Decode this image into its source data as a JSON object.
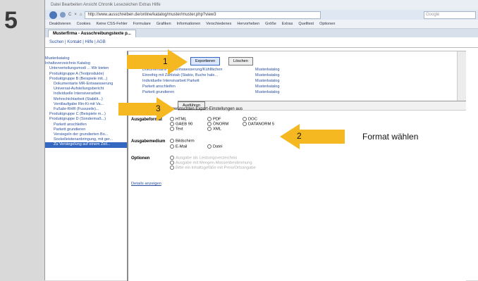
{
  "step": "5",
  "browser": {
    "title_bar": "Datei  Bearbeiten  Ansicht  Chronik  Lesezeichen  Extras  Hilfe",
    "url": "http://www.ausschreiben.de/online/katalog/muster/muster.php?view3",
    "search_placeholder": "Google",
    "bookmarks": [
      "Deaktivieren",
      "Cookies",
      "Keine CSS-Fehler",
      "Formulare",
      "Grafiken",
      "Informationen",
      "Verschiedenes",
      "Hervorheben",
      "Größe",
      "Extras",
      "Quelltext",
      "Optionen"
    ],
    "tab_label": "Musterfirma - Ausschreibungstexte p...",
    "sub_links": "Suchen | Kontakt | Hilfe | AGB"
  },
  "tree": {
    "items": [
      "Musterkatalog",
      "Inhaltsverzeichnis Katalog",
      "Unterverteilungsmodi ... Wir bieten",
      "Produktgruppe A (Testprodukte)",
      "Produktgruppe B (Beispiele mit...)",
      "Dokumentarte MR-Entwaesserung",
      "Universal-Aufstellungsbericht",
      "Individuelle Intensiverarbeit",
      "Mehrschichtarbeit (Stabilit...)",
      "Ventilaufgabe Rin-Ki mit Va...",
      "Fußabr-RHR (Fusszeile)...",
      "Produktgruppe C (Beispiele m...)",
      "Produktgruppe D (Sondermaß...)",
      "Parkett anschleifen",
      "Parkett grundieren",
      "Versiegeln der grundierten Bo...",
      "Sockelleistenanbringung, mit ger...",
      "Zu Versiegelung auf einem Zeil..."
    ]
  },
  "dialog": {
    "export_button": "Exportieren",
    "delete_button": "Löschen",
    "apply_button": "Ausführen",
    "list_items": [
      "Dokumentarte MR-Entwaesserung/Kühlfächen",
      "Einreihig mit Zählstab (Stabio, Buche hale...",
      "Individuelle Intensivarbeit Parkett",
      "Parkett anschleifen",
      "Parkett grundieren"
    ],
    "list_catalog": "Musterkatalog",
    "instruction": "Bitte wählen Sie die gewünschten Export-Einstellungen aus",
    "format_label": "Ausgabeformat",
    "format_options": [
      "HTML",
      "PDF",
      "DOC",
      "GAEB 90",
      "ÖNORM",
      "DATANORM 5",
      "Text",
      "XML"
    ],
    "medium_label": "Ausgabemedium",
    "medium_options": [
      "Bildschirm",
      "E-Mail",
      "Datei"
    ],
    "options_label": "Optionen",
    "option_items": [
      "Ausgabe als Leistungsverzeichnis",
      "Ausgabe mit Mengen-Massenbestimmung",
      "Bitte ein Inhaltsgefäße mit Preis/Ortsangabe"
    ],
    "details_link": "Details anzeigen"
  },
  "annotations": {
    "label_1": "1",
    "label_2": "2",
    "label_3": "3",
    "format_hint": "Format wählen",
    "arrow_color": "#f6b820"
  }
}
